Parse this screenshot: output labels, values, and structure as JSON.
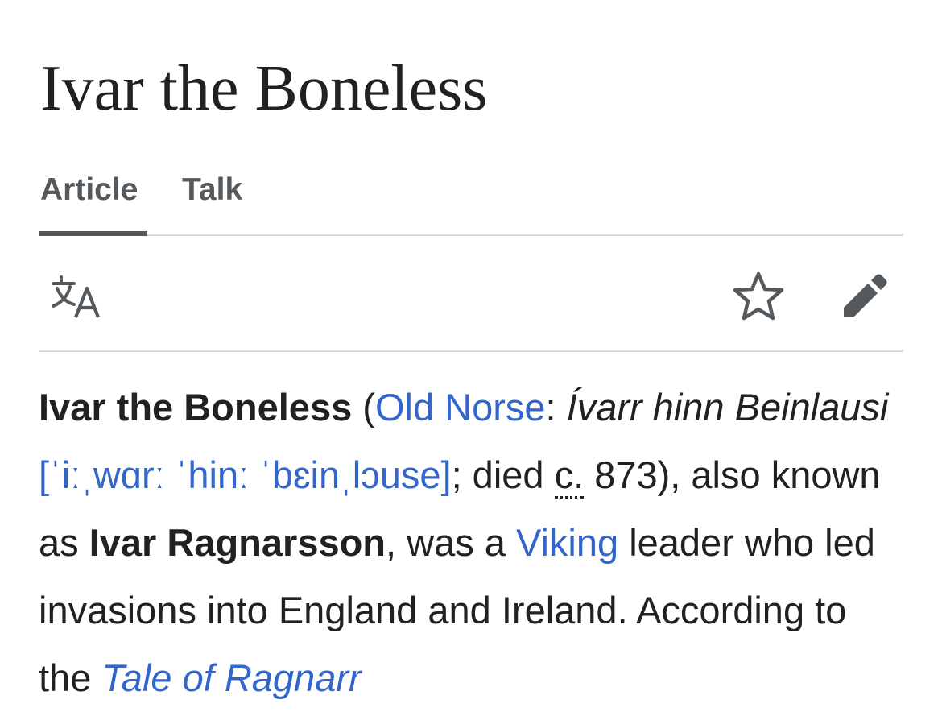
{
  "article": {
    "title": "Ivar the Boneless"
  },
  "tabs": [
    {
      "label": "Article",
      "selected": true
    },
    {
      "label": "Talk",
      "selected": false
    }
  ],
  "toolbar": {
    "language_icon": "translate-icon",
    "watch_icon": "star-outline-icon",
    "edit_icon": "pencil-icon"
  },
  "lead": {
    "subject": "Ivar the Boneless",
    "open_paren": " (",
    "lang_link": "Old Norse",
    "colon": ": ",
    "native_name": "Ívarr hinn Beinlausi",
    "space1": " ",
    "ipa_link": "[ˈiːˌwɑrː ˈhinː ˈbɛinˌlɔuse]",
    "died_text": "; died ",
    "circa": "c.",
    "died_year": " 873), also known as ",
    "alt_name": "Ivar Ragnarsson",
    "was_a": ", was a ",
    "viking_link": "Viking",
    "rest_text": " leader who led invasions into England and Ireland. According to the ",
    "tale_link": "Tale of Ragnarr"
  },
  "colors": {
    "link": "#3366cc",
    "text": "#202122",
    "muted": "#54595d",
    "divider": "#d9dbde"
  }
}
